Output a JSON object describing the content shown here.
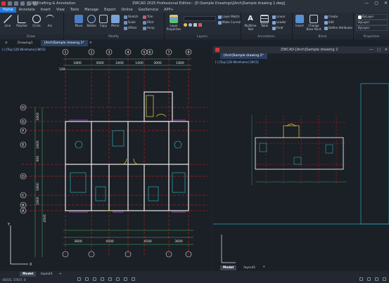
{
  "titlebar": {
    "title": "ZWCAD 2025 Professional Edition - [E:\\Sample Drawings\\[Arch]Sample drawing 1.dwg]",
    "workspace": "2D Drafting & Annotation",
    "minimize": "—",
    "maximize": "▢",
    "close": "✕"
  },
  "menu": [
    "Home",
    "Annotate",
    "Insert",
    "View",
    "Tools",
    "Manage",
    "Export",
    "Online",
    "GeoService",
    "APP+"
  ],
  "ribbon": {
    "draw": {
      "label": "Draw",
      "line": "Line",
      "polyline": "Polyline",
      "circle": "Circle",
      "arc": "Arc"
    },
    "modify": {
      "label": "Modify",
      "move": "Move",
      "rotate": "Rotate",
      "copy": "Copy",
      "mirror": "Mirror",
      "stretch": "Stretch",
      "scale": "Scale",
      "offset": "Offset",
      "trim": "Trim",
      "fillet": "Fillet",
      "array": "Array"
    },
    "layers": {
      "label": "Layers",
      "props": "Layer Properties",
      "match": "Layer Match",
      "current": "Make Current"
    },
    "annotation": {
      "label": "Annotation",
      "mtext": "Multiline Text",
      "table": "Table",
      "linear": "Linear",
      "leader": "Leader",
      "field": "Field"
    },
    "block": {
      "label": "Block",
      "insert": "Insert",
      "change_base": "Change Base Point",
      "create": "Create",
      "edit": "Edit",
      "define_attr": "Define Attributes"
    },
    "properties": {
      "label": "Properties",
      "bylayer": "ByLayer"
    }
  },
  "doctabs": {
    "drawing1": "Drawing1",
    "sample1": "[Arch]Sample drawing 1*"
  },
  "right": {
    "title": "ZWCAD-[Arch]Sample drawing 2",
    "tab": "[Arch]Sample drawing 2*",
    "vplabel": "[-] [Top] [2D Wireframe] [WCS]"
  },
  "left": {
    "vplabel": "[-] [Top] [2D Wireframe] [WCS]"
  },
  "status": {
    "model": "Model",
    "layout1": "layout1",
    "add": "+",
    "coords": "-45035, 17657, 0"
  },
  "dims": {
    "top": [
      "1800",
      "3000",
      "2400",
      "1400",
      "3000",
      "1800",
      "120"
    ],
    "bottom": [
      "3600",
      "4500",
      "4500",
      "3600",
      "3600"
    ],
    "left": [
      "1800",
      "2400",
      "900",
      "1800",
      "1800",
      "1800",
      "3300",
      "2700",
      "4500"
    ],
    "grid_top": [
      "1",
      "2",
      "3",
      "4",
      "5",
      "6",
      "7",
      "8"
    ],
    "grid_left": [
      "H",
      "G",
      "F",
      "E",
      "D",
      "C",
      "B",
      "A"
    ]
  }
}
